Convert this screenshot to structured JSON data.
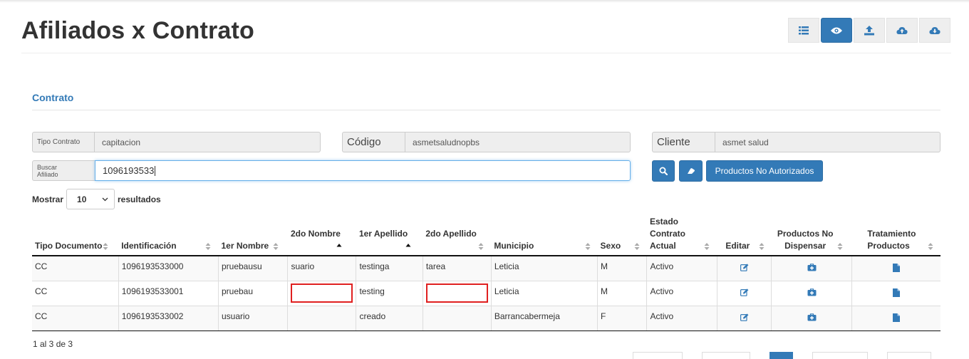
{
  "page": {
    "title": "Afiliados x Contrato"
  },
  "toolbar": {
    "buttons": [
      {
        "icon": "list-icon",
        "active": false
      },
      {
        "icon": "eye-icon",
        "active": true
      },
      {
        "icon": "upload-icon",
        "active": false
      },
      {
        "icon": "cloud-upload-icon",
        "active": false
      },
      {
        "icon": "cloud-download-icon",
        "active": false
      }
    ]
  },
  "contract": {
    "section_title": "Contrato",
    "tipo_label": "Tipo Contrato",
    "tipo_value": "capitacion",
    "codigo_label": "Código",
    "codigo_value": "asmetsaludnopbs",
    "cliente_label": "Cliente",
    "cliente_value": "asmet salud",
    "buscar_label_1": "Buscar",
    "buscar_label_2": "Afiliado",
    "buscar_value": "1096193533",
    "search_icon": "search-icon",
    "eraser_icon": "eraser-icon",
    "productos_button": "Productos No Autorizados"
  },
  "length": {
    "show_label": "Mostrar",
    "value": "10",
    "suffix": "resultados"
  },
  "table": {
    "headers": {
      "tipo": "Tipo Documento",
      "identificacion": "Identificación",
      "nombre1": "1er Nombre",
      "nombre2": "2do Nombre",
      "apellido1": "1er Apellido",
      "apellido2": "2do Apellido",
      "municipio": "Municipio",
      "sexo": "Sexo",
      "estado_1": "Estado",
      "estado_2": "Contrato",
      "estado_3": "Actual",
      "editar": "Editar",
      "productos_1": "Productos No",
      "productos_2": "Dispensar",
      "tratamiento_1": "Tratamiento",
      "tratamiento_2": "Productos"
    },
    "rows": [
      {
        "tipo": "CC",
        "identificacion": "1096193533000",
        "nombre1": "pruebausu",
        "nombre2": "suario",
        "apellido1": "testinga",
        "apellido2": "tarea",
        "municipio": "Leticia",
        "sexo": "M",
        "estado": "Activo"
      },
      {
        "tipo": "CC",
        "identificacion": "1096193533001",
        "nombre1": "pruebau",
        "nombre2": "",
        "apellido1": "testing",
        "apellido2": "",
        "municipio": "Leticia",
        "sexo": "M",
        "estado": "Activo"
      },
      {
        "tipo": "CC",
        "identificacion": "1096193533002",
        "nombre1": "usuario",
        "nombre2": "",
        "apellido1": "creado",
        "apellido2": "",
        "municipio": "Barrancabermeja",
        "sexo": "F",
        "estado": "Activo"
      }
    ],
    "row_icons": {
      "editar": "edit-icon",
      "productos": "medkit-icon",
      "tratamiento": "file-icon"
    }
  },
  "footer": {
    "info": "1 al 3 de 3"
  },
  "colors": {
    "primary": "#337ab7",
    "highlight_box": "#e02020",
    "section_title": "#337ab7"
  }
}
